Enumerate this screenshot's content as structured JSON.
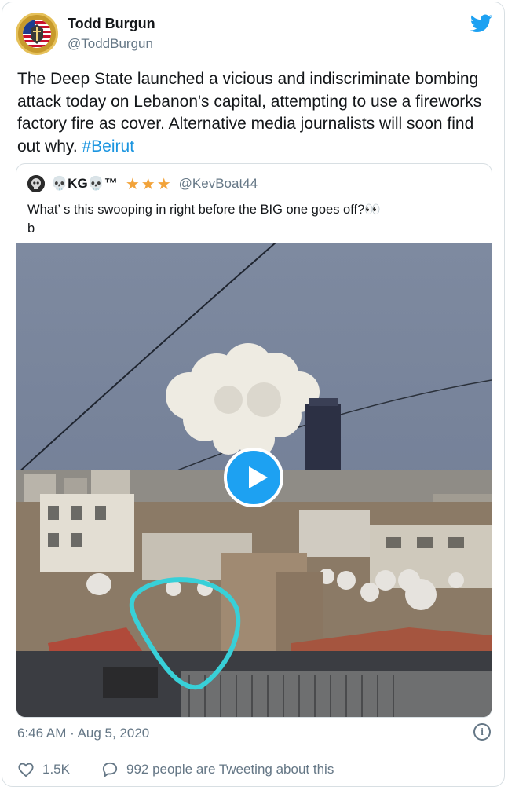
{
  "author": {
    "name": "Todd Burgun",
    "handle": "@ToddBurgun"
  },
  "tweet": {
    "text": "The Deep State launched a vicious and indiscriminate bombing attack today on Lebanon's capital, attempting to use a fireworks factory fire as cover. Alternative media journalists will soon find out why. ",
    "hashtag": "#Beirut",
    "timestamp": "6:46 AM · Aug 5, 2020"
  },
  "quoted": {
    "name": "💀KG💀™",
    "stars": "★★★",
    "handle": "@KevBoat44",
    "text": "What’ s this swooping in right before the BIG one goes off?👀",
    "text_line2": "b"
  },
  "stats": {
    "likes": "1.5K",
    "replies": "992 people are Tweeting about this"
  },
  "colors": {
    "brand": "#1da1f2",
    "link": "#1b95e0",
    "muted": "#657786",
    "stars": "#f2a33a",
    "annotation": "#38d0d8"
  },
  "icons": [
    "twitter-bird-icon",
    "play-icon",
    "info-icon",
    "heart-icon",
    "reply-icon"
  ]
}
